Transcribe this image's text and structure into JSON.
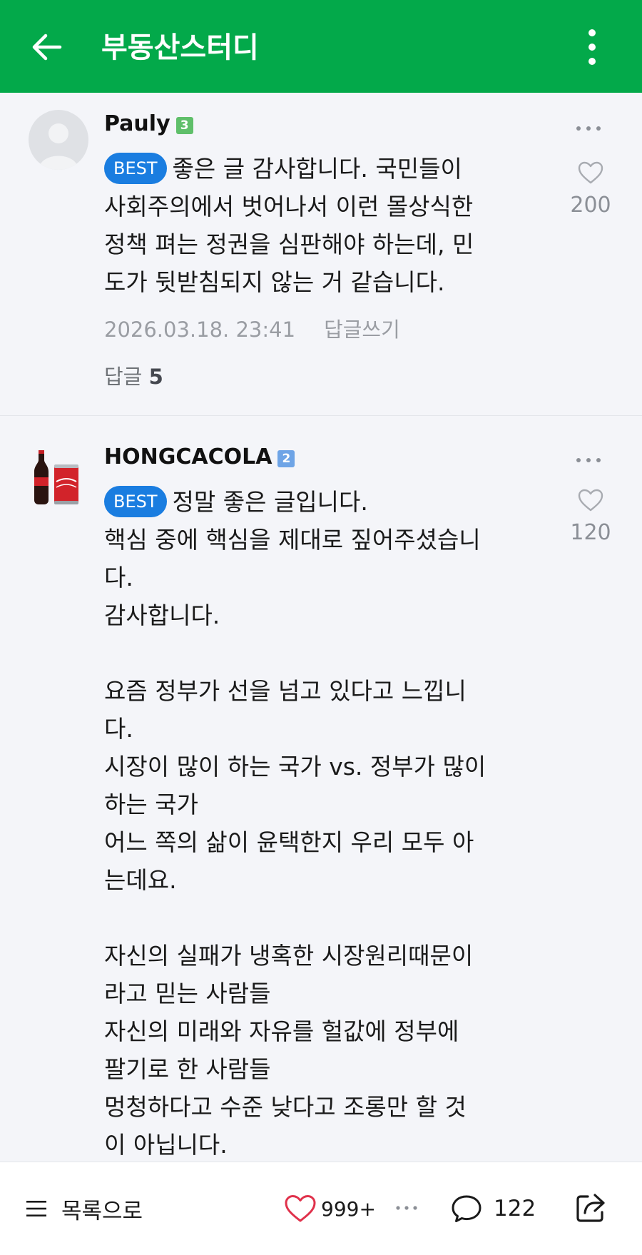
{
  "header": {
    "title": "부동산스터디",
    "bg_color": "#03a94a",
    "back_icon": "arrow-left-icon",
    "menu_icon": "more-vertical-icon"
  },
  "comments": [
    {
      "nickname": "Pauly",
      "grade": "3",
      "badge": "BEST",
      "text": "좋은 글 감사합니다. 국민들이\n사회주의에서 벗어나서 이런 몰상식한\n정책 펴는 정권을 심판해야 하는데, 민\n도가 뒷받침되지 않는 거 같습니다.",
      "likes": "200",
      "date": "2026.03.18. 23:41",
      "reply_write": "답글쓰기",
      "reply_label": "답글",
      "reply_count": "5"
    },
    {
      "nickname": "HONGCACOLA",
      "grade": "2",
      "badge": "BEST",
      "text": "정말 좋은 글입니다.\n핵심 중에 핵심을 제대로 짚어주셨습니\n다.\n감사합니다.\n\n요즘 정부가 선을 넘고 있다고 느낍니\n다.\n시장이 많이 하는 국가 vs. 정부가 많이\n하는 국가\n어느 쪽의 삶이 윤택한지 우리 모두 아\n는데요.\n\n자신의 실패가 냉혹한 시장원리때문이\n라고 믿는 사람들\n자신의 미래와 자유를 헐값에 정부에\n팔기로 한 사람들\n멍청하다고 수준 낮다고 조롱만 할 것\n이 아닙니다.",
      "likes": "120"
    }
  ],
  "bottom_bar": {
    "list_label": "목록으로",
    "like_count": "999+",
    "comment_count": "122",
    "share_icon": "share-icon",
    "heart_color": "#e0314b"
  }
}
